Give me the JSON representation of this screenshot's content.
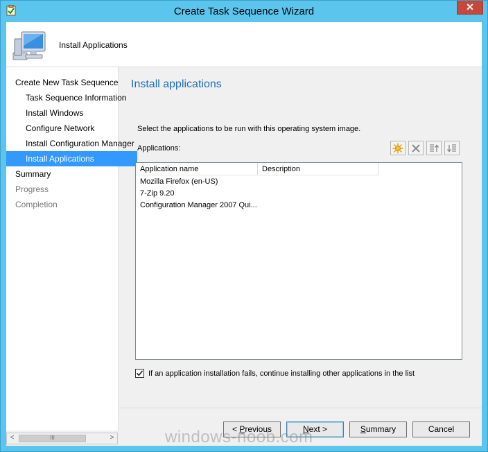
{
  "window": {
    "title": "Create Task Sequence Wizard",
    "close_glyph": "✕"
  },
  "header": {
    "title": "Install Applications",
    "icon": "computer-monitor-icon"
  },
  "nav": {
    "items": [
      {
        "label": "Create New Task Sequence",
        "indent": 0,
        "state": "normal"
      },
      {
        "label": "Task Sequence Information",
        "indent": 1,
        "state": "normal"
      },
      {
        "label": "Install Windows",
        "indent": 1,
        "state": "normal"
      },
      {
        "label": "Configure Network",
        "indent": 1,
        "state": "normal"
      },
      {
        "label": "Install Configuration Manager",
        "indent": 1,
        "state": "normal"
      },
      {
        "label": "Install Applications",
        "indent": 1,
        "state": "selected"
      },
      {
        "label": "Summary",
        "indent": 0,
        "state": "normal"
      },
      {
        "label": "Progress",
        "indent": 0,
        "state": "disabled"
      },
      {
        "label": "Completion",
        "indent": 0,
        "state": "disabled"
      }
    ],
    "scrollbar": {
      "left_glyph": "<",
      "right_glyph": ">",
      "thumb_grip": "III"
    }
  },
  "content": {
    "title": "Install applications",
    "instruction": "Select the applications to be run with this operating system image.",
    "apps_label": "Applications:",
    "toolbar": [
      "new-icon",
      "delete-icon",
      "move-up-icon",
      "move-down-icon"
    ],
    "columns": [
      "Application name",
      "Description"
    ],
    "rows": [
      [
        "Mozilla Firefox (en-US)",
        ""
      ],
      [
        "7-Zip 9.20",
        ""
      ],
      [
        "Configuration Manager 2007 Qui...",
        ""
      ]
    ],
    "continue_on_fail": {
      "checked": true,
      "label": "If an application installation fails, continue installing other applications in the list"
    }
  },
  "buttons": {
    "previous": "Previous",
    "next": "Next",
    "summary": "Summary",
    "cancel": "Cancel"
  },
  "watermark": "windows-noob.com",
  "colors": {
    "title_bar": "#5bc5ee",
    "selection": "#3399ff",
    "heading": "#1e6fb5",
    "close": "#c7483a"
  }
}
